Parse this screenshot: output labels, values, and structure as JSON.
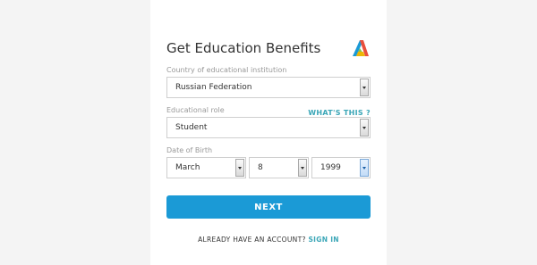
{
  "form": {
    "title": "Get Education Benefits",
    "country_label": "Country of educational institution",
    "country_value": "Russian Federation",
    "role_label": "Educational role",
    "whats_this": "WHAT'S THIS ?",
    "role_value": "Student",
    "dob_label": "Date of Birth",
    "dob_month": "March",
    "dob_day": "8",
    "dob_year": "1999",
    "next_label": "NEXT",
    "account_text": "ALREADY HAVE AN ACCOUNT?",
    "signin_label": "SIGN IN"
  },
  "colors": {
    "accent": "#1b9ad6",
    "link": "#3aa6b7"
  },
  "icons": {
    "logo": "autodesk-logo-icon",
    "select_arrow": "chevron-down-icon"
  }
}
